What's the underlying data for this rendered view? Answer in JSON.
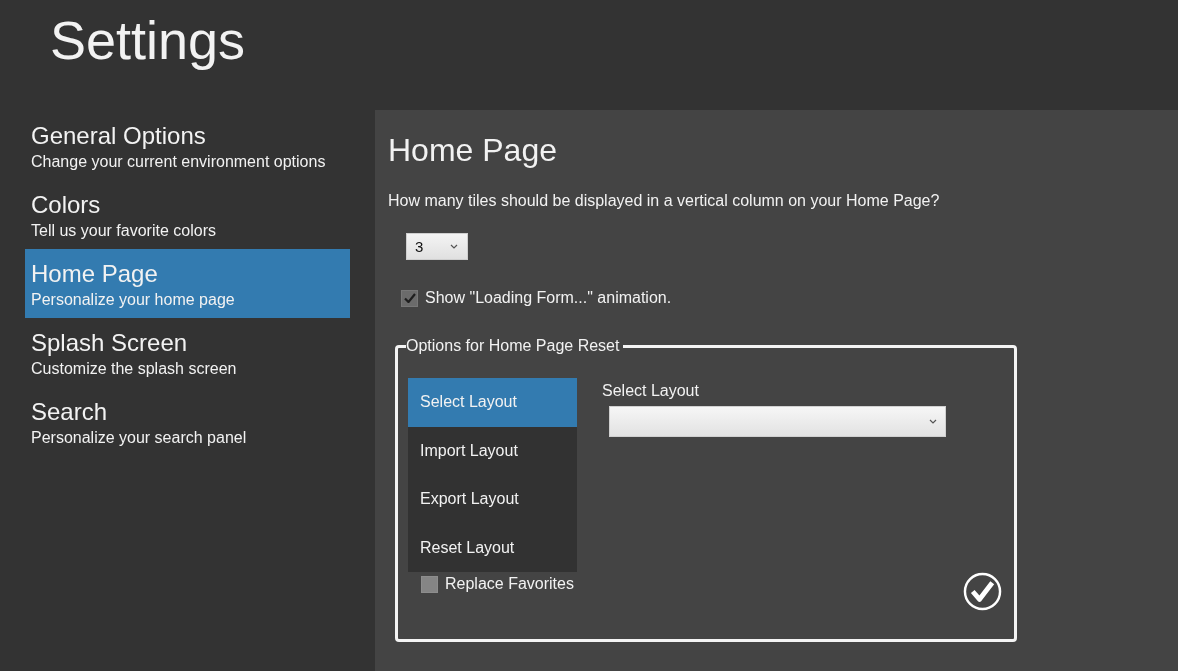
{
  "title": "Settings",
  "sidebar": {
    "items": [
      {
        "title": "General Options",
        "subtitle": "Change your current environment options",
        "selected": false
      },
      {
        "title": "Colors",
        "subtitle": "Tell us your favorite colors",
        "selected": false
      },
      {
        "title": "Home Page",
        "subtitle": "Personalize your home page",
        "selected": true
      },
      {
        "title": "Splash Screen",
        "subtitle": "Customize the splash screen",
        "selected": false
      },
      {
        "title": "Search",
        "subtitle": "Personalize your search panel",
        "selected": false
      }
    ]
  },
  "content": {
    "heading": "Home Page",
    "question": "How many tiles should be displayed in a vertical column on your Home Page?",
    "tiles_dropdown": {
      "value": "3"
    },
    "loading_animation": {
      "label": "Show \"Loading Form...\" animation.",
      "checked": true
    },
    "reset_group": {
      "legend": "Options for Home Page Reset",
      "actions": [
        {
          "label": "Select Layout",
          "selected": true
        },
        {
          "label": "Import Layout",
          "selected": false
        },
        {
          "label": "Export Layout",
          "selected": false
        },
        {
          "label": "Reset Layout",
          "selected": false
        }
      ],
      "layout_field": {
        "label": "Select Layout"
      },
      "replace_favorites": {
        "label": "Replace Favorites",
        "checked": false
      }
    }
  }
}
